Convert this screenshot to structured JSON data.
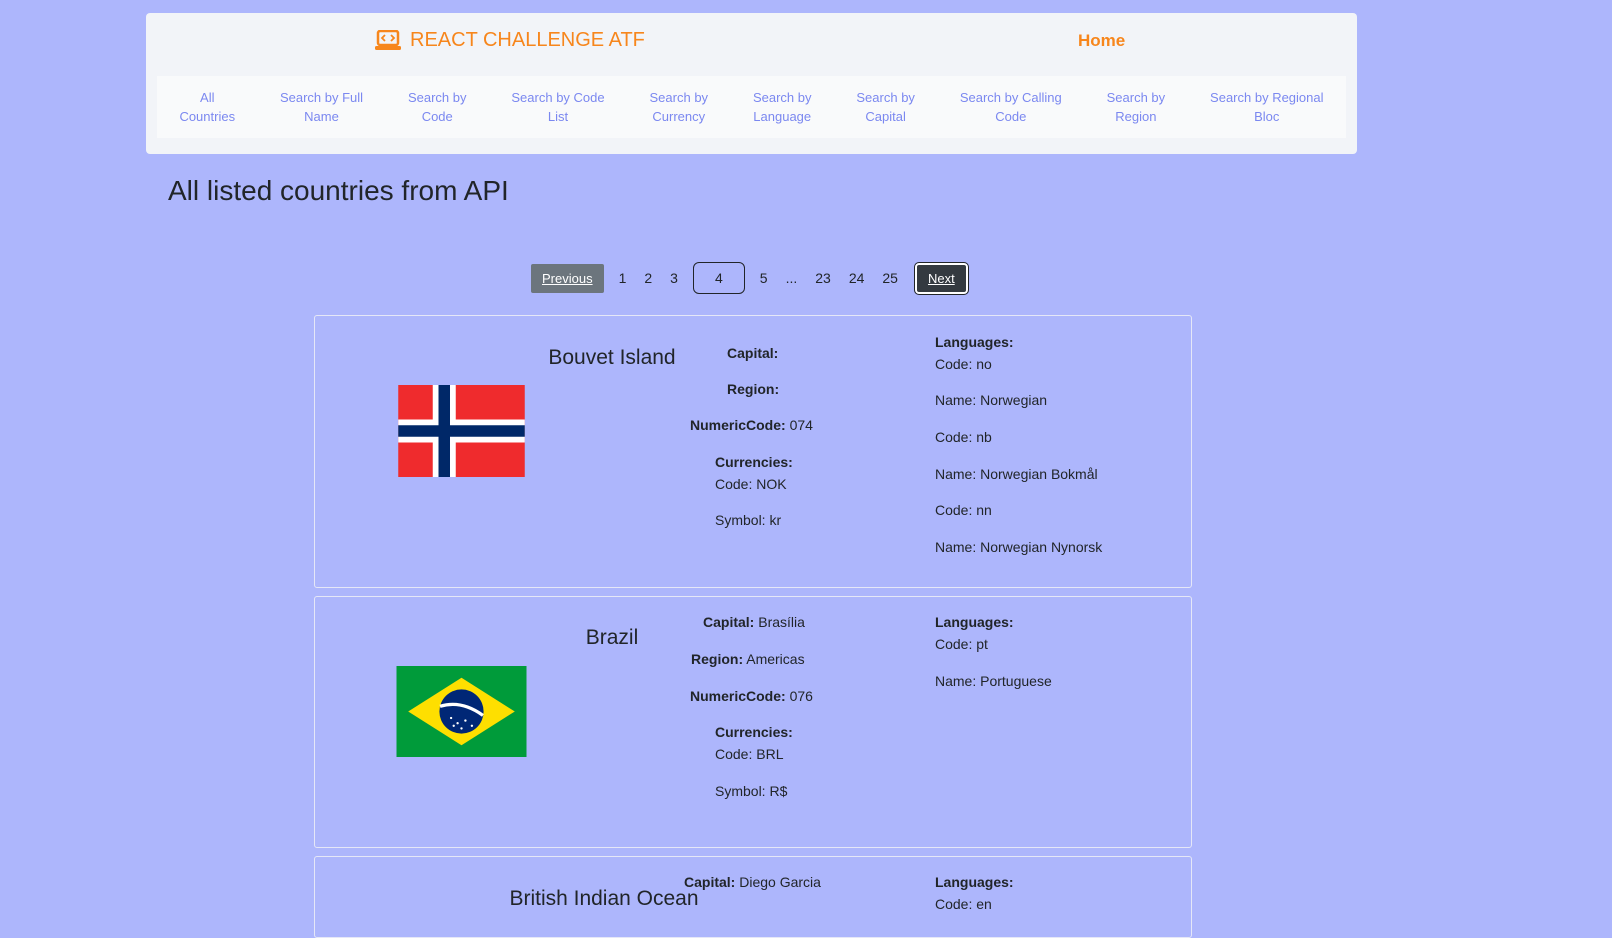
{
  "header": {
    "brand": "REACT CHALLENGE ATF",
    "home": "Home",
    "nav": [
      "All\nCountries",
      "Search by Full\nName",
      "Search by\nCode",
      "Search by Code\nList",
      "Search by\nCurrency",
      "Search by\nLanguage",
      "Search by\nCapital",
      "Search by Calling\nCode",
      "Search by\nRegion",
      "Search by Regional\nBloc"
    ]
  },
  "main": {
    "title": "All listed countries from API"
  },
  "pagination": {
    "previous": "Previous",
    "pages": [
      "1",
      "2",
      "3",
      "4",
      "5",
      "...",
      "23",
      "24",
      "25"
    ],
    "current": "4",
    "next": "Next"
  },
  "labels": {
    "capital": "Capital:",
    "region": "Region:",
    "numeric": "NumericCode:",
    "currencies": "Currencies:",
    "languages": "Languages:"
  },
  "countries": [
    {
      "name": "Bouvet Island",
      "capital": "",
      "region": "",
      "numeric": "074",
      "currency_code": "Code: NOK",
      "currency_symbol": "Symbol: kr",
      "languages": [
        "Code: no",
        "Name: Norwegian",
        "Code: nb",
        "Name: Norwegian Bokmål",
        "Code: nn",
        "Name: Norwegian Nynorsk"
      ]
    },
    {
      "name": "Brazil",
      "capital": "Brasília",
      "region": "Americas",
      "numeric": "076",
      "currency_code": "Code: BRL",
      "currency_symbol": "Symbol: R$",
      "languages": [
        "Code: pt",
        "Name: Portuguese"
      ]
    },
    {
      "name": "British Indian Ocean",
      "capital": "Diego Garcia",
      "languages_first": "Code: en"
    }
  ],
  "colors": {
    "background": "#adb6fc",
    "brand": "#f7861c",
    "nav_link": "#7b88f0"
  }
}
